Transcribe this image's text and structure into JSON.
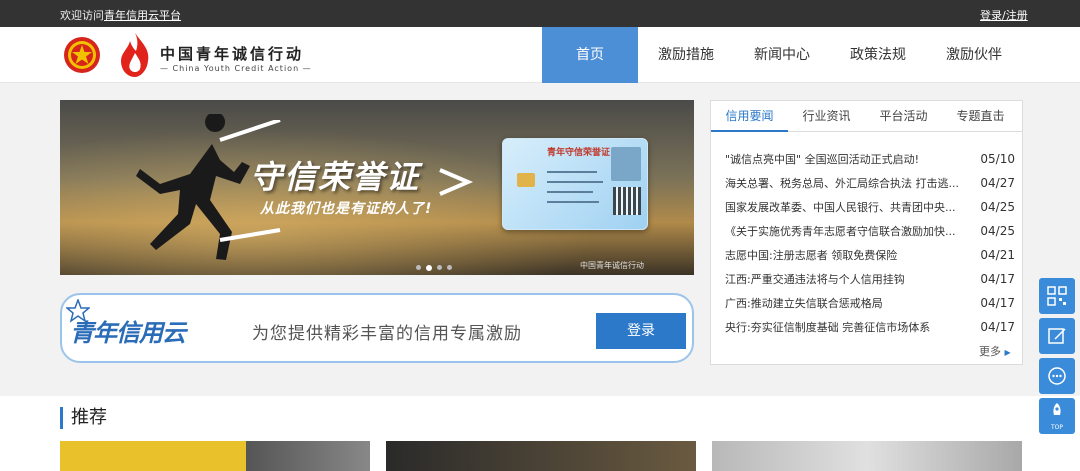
{
  "topbar": {
    "welcome_prefix": "欢迎访问",
    "platform_name": "青年信用云平台",
    "login_register": "登录/注册"
  },
  "header": {
    "brand_cn": "中国青年诚信行动",
    "brand_en": "— China Youth Credit Action —"
  },
  "nav": {
    "items": [
      "首页",
      "激励措施",
      "新闻中心",
      "政策法规",
      "激励伙伴"
    ],
    "active": "首页"
  },
  "banner": {
    "title": "守信荣誉证",
    "subtitle": "从此我们也是有证的人了!",
    "card_title": "青年守信荣誉证",
    "caption": "中国青年诚信行动"
  },
  "cloud": {
    "logo": "青年信用云",
    "slogan": "为您提供精彩丰富的信用专属激励",
    "login_button": "登录"
  },
  "news": {
    "tabs": [
      "信用要闻",
      "行业资讯",
      "平台活动",
      "专题直击"
    ],
    "active_tab": "信用要闻",
    "items": [
      {
        "title": "\"诚信点亮中国\" 全国巡回活动正式启动!",
        "date": "05/10"
      },
      {
        "title": "海关总署、税务总局、外汇局综合执法 打击逃...",
        "date": "04/27"
      },
      {
        "title": "国家发展改革委、中国人民银行、共青团中央...",
        "date": "04/25"
      },
      {
        "title": "《关于实施优秀青年志愿者守信联合激励加快...",
        "date": "04/25"
      },
      {
        "title": "志愿中国:注册志愿者 领取免费保险",
        "date": "04/21"
      },
      {
        "title": "江西:严重交通违法将与个人信用挂钩",
        "date": "04/17"
      },
      {
        "title": "广西:推动建立失信联合惩戒格局",
        "date": "04/17"
      },
      {
        "title": "央行:夯实征信制度基础 完善征信市场体系",
        "date": "04/17"
      }
    ],
    "more": "更多"
  },
  "recommend": {
    "title": "推荐"
  },
  "tools": {
    "top_label": "TOP"
  },
  "colors": {
    "accent": "#2c78c9",
    "nav_active": "#4d8fd6",
    "topbar": "#333333"
  }
}
